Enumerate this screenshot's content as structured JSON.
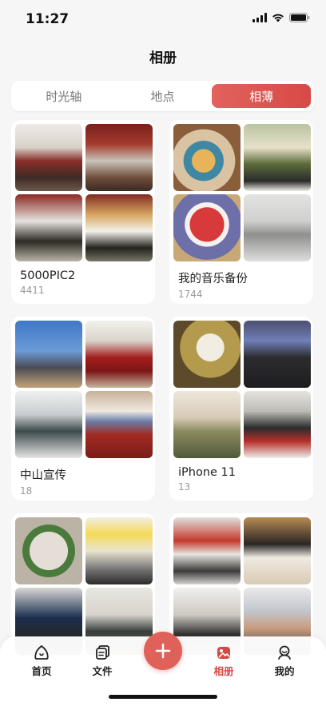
{
  "status_bar": {
    "time": "11:27"
  },
  "header": {
    "title": "相册"
  },
  "segment": {
    "items": [
      {
        "label": "时光轴",
        "active": false
      },
      {
        "label": "地点",
        "active": false
      },
      {
        "label": "相薄",
        "active": true
      }
    ]
  },
  "albums": [
    {
      "name": "5000PIC2",
      "count": "4411"
    },
    {
      "name": "我的音乐备份",
      "count": "1744"
    },
    {
      "name": "中山宣传",
      "count": "18"
    },
    {
      "name": "iPhone 11",
      "count": "13"
    },
    {
      "name": "",
      "count": ""
    },
    {
      "name": "",
      "count": ""
    }
  ],
  "tab_bar": {
    "items": [
      {
        "label": "首页",
        "icon": "home-icon",
        "active": false
      },
      {
        "label": "文件",
        "icon": "files-icon",
        "active": false
      },
      {
        "label": "相册",
        "icon": "album-icon",
        "active": true
      },
      {
        "label": "我的",
        "icon": "profile-icon",
        "active": false
      }
    ],
    "fab_icon": "plus-icon"
  },
  "colors": {
    "accent": "#d64a45",
    "background": "#f6f6f6"
  }
}
